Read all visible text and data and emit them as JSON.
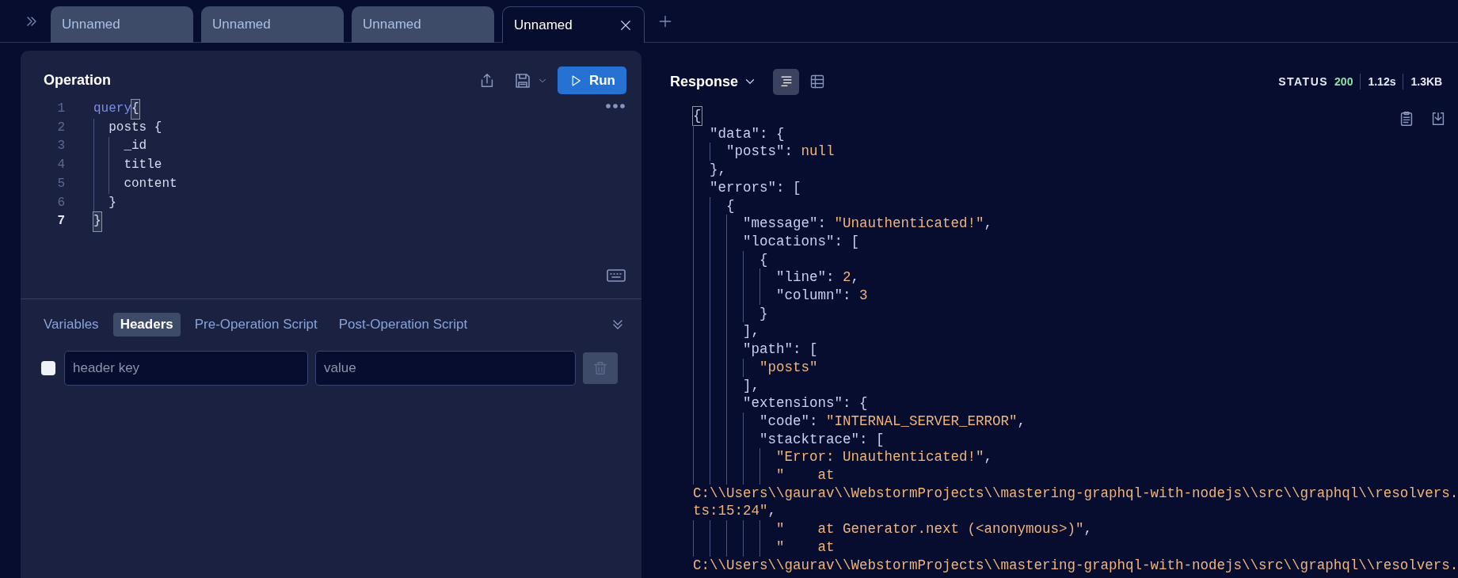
{
  "tabs": [
    {
      "label": "Unnamed",
      "selected": false
    },
    {
      "label": "Unnamed",
      "selected": false
    },
    {
      "label": "Unnamed",
      "selected": false
    },
    {
      "label": "Unnamed",
      "selected": true
    }
  ],
  "operation": {
    "title": "Operation",
    "run_label": "Run",
    "lines": [
      {
        "number": "1",
        "current": false,
        "tokens": [
          {
            "t": "query",
            "kind": "kw"
          },
          {
            "t": "{",
            "kind": "match"
          }
        ]
      },
      {
        "number": "2",
        "current": false,
        "tokens": [
          {
            "t": "  posts {",
            "kind": "plain"
          }
        ]
      },
      {
        "number": "3",
        "current": false,
        "tokens": [
          {
            "t": "    _id",
            "kind": "plain"
          }
        ]
      },
      {
        "number": "4",
        "current": false,
        "tokens": [
          {
            "t": "    title",
            "kind": "plain"
          }
        ]
      },
      {
        "number": "5",
        "current": false,
        "tokens": [
          {
            "t": "    content",
            "kind": "plain"
          }
        ]
      },
      {
        "number": "6",
        "current": false,
        "tokens": [
          {
            "t": "  }",
            "kind": "plain"
          }
        ]
      },
      {
        "number": "7",
        "current": true,
        "tokens": [
          {
            "t": "}",
            "kind": "match"
          }
        ]
      }
    ]
  },
  "bottom_tabs": [
    {
      "label": "Variables",
      "selected": false
    },
    {
      "label": "Headers",
      "selected": true
    },
    {
      "label": "Pre-Operation Script",
      "selected": false
    },
    {
      "label": "Post-Operation Script",
      "selected": false
    }
  ],
  "header_row": {
    "checked": false,
    "key_placeholder": "header key",
    "value_placeholder": "value",
    "delete_disabled": true
  },
  "response": {
    "title": "Response",
    "views": [
      {
        "kind": "text",
        "selected": true
      },
      {
        "kind": "table",
        "selected": false
      }
    ],
    "status": {
      "label": "STATUS",
      "code": "200",
      "time": "1.12s",
      "size": "1.3KB"
    },
    "lines": [
      [
        {
          "t": "{",
          "kind": "match"
        }
      ],
      [
        {
          "t": "  \"data\": {",
          "kind": "p"
        }
      ],
      [
        {
          "t": "    \"posts\": ",
          "kind": "p"
        },
        {
          "t": "null",
          "kind": "v"
        }
      ],
      [
        {
          "t": "  },",
          "kind": "p"
        }
      ],
      [
        {
          "t": "  \"errors\": [",
          "kind": "p"
        }
      ],
      [
        {
          "t": "    {",
          "kind": "p"
        }
      ],
      [
        {
          "t": "      \"message\": ",
          "kind": "p"
        },
        {
          "t": "\"Unauthenticated!\"",
          "kind": "v"
        },
        {
          "t": ",",
          "kind": "p"
        }
      ],
      [
        {
          "t": "      \"locations\": [",
          "kind": "p"
        }
      ],
      [
        {
          "t": "        {",
          "kind": "p"
        }
      ],
      [
        {
          "t": "          \"line\": ",
          "kind": "p"
        },
        {
          "t": "2",
          "kind": "v"
        },
        {
          "t": ",",
          "kind": "p"
        }
      ],
      [
        {
          "t": "          \"column\": ",
          "kind": "p"
        },
        {
          "t": "3",
          "kind": "v"
        }
      ],
      [
        {
          "t": "        }",
          "kind": "p"
        }
      ],
      [
        {
          "t": "      ],",
          "kind": "p"
        }
      ],
      [
        {
          "t": "      \"path\": [",
          "kind": "p"
        }
      ],
      [
        {
          "t": "        \"posts\"",
          "kind": "v"
        }
      ],
      [
        {
          "t": "      ],",
          "kind": "p"
        }
      ],
      [
        {
          "t": "      \"extensions\": {",
          "kind": "p"
        }
      ],
      [
        {
          "t": "        \"code\": ",
          "kind": "p"
        },
        {
          "t": "\"INTERNAL_SERVER_ERROR\"",
          "kind": "v"
        },
        {
          "t": ",",
          "kind": "p"
        }
      ],
      [
        {
          "t": "        \"stacktrace\": [",
          "kind": "p"
        }
      ],
      [
        {
          "t": "          \"Error: Unauthenticated!\"",
          "kind": "v"
        },
        {
          "t": ",",
          "kind": "p"
        }
      ],
      [
        {
          "t": "          \"    at",
          "kind": "v"
        }
      ],
      [
        {
          "t": "C:\\\\Users\\\\gaurav\\\\WebstormProjects\\\\mastering-graphql-with-nodejs\\\\src\\\\graphql\\\\resolvers.",
          "kind": "v"
        }
      ],
      [
        {
          "t": "ts:15:24\"",
          "kind": "v"
        },
        {
          "t": ",",
          "kind": "p"
        }
      ],
      [
        {
          "t": "          \"    at Generator.next (<anonymous>)\"",
          "kind": "v"
        },
        {
          "t": ",",
          "kind": "p"
        }
      ],
      [
        {
          "t": "          \"    at",
          "kind": "v"
        }
      ],
      [
        {
          "t": "C:\\\\Users\\\\gaurav\\\\WebstormProjects\\\\mastering-graphql-with-nodejs\\\\src\\\\graphql\\\\resolvers.",
          "kind": "v"
        }
      ]
    ]
  }
}
